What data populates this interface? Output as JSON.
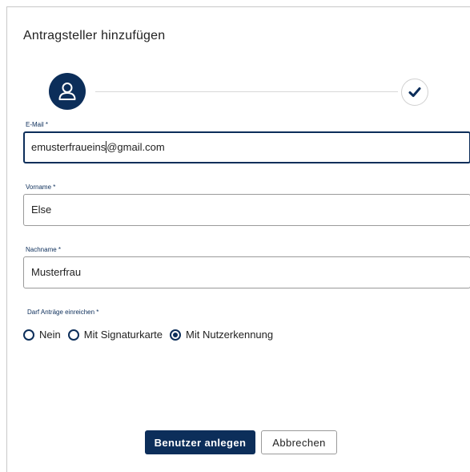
{
  "dialog": {
    "title": "Antragsteller hinzufügen"
  },
  "stepper": {
    "steps": [
      {
        "icon": "user-icon",
        "state": "active"
      },
      {
        "icon": "check-icon",
        "state": "pending"
      }
    ]
  },
  "form": {
    "email": {
      "label": "E-Mail *",
      "value_before_caret": "emusterfraueins",
      "value_after_caret": "@gmail.com"
    },
    "firstname": {
      "label": "Vorname *",
      "value": "Else"
    },
    "lastname": {
      "label": "Nachname *",
      "value": "Musterfrau"
    },
    "permission": {
      "label": "Darf Anträge einreichen *",
      "options": [
        {
          "label": "Nein",
          "selected": false
        },
        {
          "label": "Mit Signaturkarte",
          "selected": false
        },
        {
          "label": "Mit Nutzerkennung",
          "selected": true
        }
      ]
    }
  },
  "actions": {
    "create_label": "Benutzer anlegen",
    "cancel_label": "Abbrechen"
  },
  "colors": {
    "primary": "#0c2e5a",
    "border": "#9a9a9a"
  }
}
